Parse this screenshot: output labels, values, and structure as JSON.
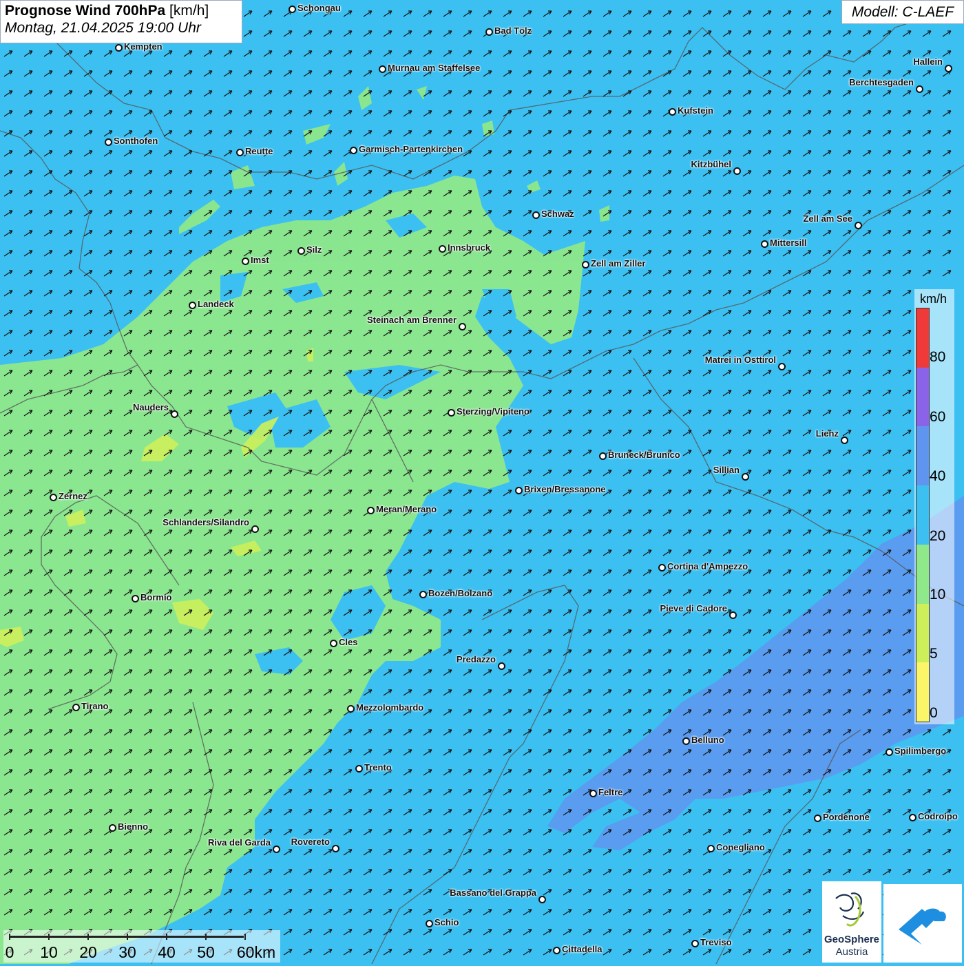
{
  "title": {
    "bold": "Prognose Wind 700hPa",
    "unit": " [km/h]",
    "datetime": "Montag, 21.04.2025 19:00 Uhr"
  },
  "model_label": "Modell: C-LAEF",
  "legend": {
    "unit": "km/h",
    "labels": [
      "80",
      "60",
      "40",
      "20",
      "10",
      "5",
      "0"
    ],
    "colors": [
      "#f03a3a",
      "#8a63e8",
      "#5f95ee",
      "#3cc0f2",
      "#8fe88a",
      "#cdf05a",
      "#fbf56a"
    ]
  },
  "scale_bar": {
    "labels": [
      "0",
      "10",
      "20",
      "30",
      "40",
      "50",
      "60km"
    ]
  },
  "wind_direction": "north-east",
  "cities": [
    {
      "name": "Schongau"
    },
    {
      "name": "Bad Tölz"
    },
    {
      "name": "Kempten"
    },
    {
      "name": "Murnau am Staffelsee"
    },
    {
      "name": "Hallein"
    },
    {
      "name": "Berchtesgaden"
    },
    {
      "name": "Kufstein"
    },
    {
      "name": "Sonthofen"
    },
    {
      "name": "Reutte"
    },
    {
      "name": "Garmisch-Partenkirchen"
    },
    {
      "name": "Kitzbühel"
    },
    {
      "name": "Schwaz"
    },
    {
      "name": "Zell am See"
    },
    {
      "name": "Mittersill"
    },
    {
      "name": "Imst"
    },
    {
      "name": "Silz"
    },
    {
      "name": "Innsbruck"
    },
    {
      "name": "Zell am Ziller"
    },
    {
      "name": "Landeck"
    },
    {
      "name": "Steinach am Brenner"
    },
    {
      "name": "Matrei in Osttirol"
    },
    {
      "name": "Nauders"
    },
    {
      "name": "Sterzing/Vipiteno"
    },
    {
      "name": "Lienz"
    },
    {
      "name": "Bruneck/Brunico"
    },
    {
      "name": "Sillian"
    },
    {
      "name": "Zernez"
    },
    {
      "name": "Brixen/Bressanone"
    },
    {
      "name": "Meran/Merano"
    },
    {
      "name": "Schlanders/Silandro"
    },
    {
      "name": "Cortina d'Ampezzo"
    },
    {
      "name": "Bozen/Bolzano"
    },
    {
      "name": "Bormio"
    },
    {
      "name": "Pieve di Cadore"
    },
    {
      "name": "Cles"
    },
    {
      "name": "Predazzo"
    },
    {
      "name": "Tirano"
    },
    {
      "name": "Mezzolombardo"
    },
    {
      "name": "Belluno"
    },
    {
      "name": "Spilimbergo"
    },
    {
      "name": "Trento"
    },
    {
      "name": "Feltre"
    },
    {
      "name": "Pordenone"
    },
    {
      "name": "Codroipo"
    },
    {
      "name": "Bienno"
    },
    {
      "name": "Riva del Garda"
    },
    {
      "name": "Rovereto"
    },
    {
      "name": "Conegliano"
    },
    {
      "name": "Bassano del Grappa"
    },
    {
      "name": "Schio"
    },
    {
      "name": "Treviso"
    },
    {
      "name": "Cittadella"
    }
  ],
  "logos": {
    "geosphere_line1": "GeoSphere",
    "geosphere_line2": "Austria"
  }
}
